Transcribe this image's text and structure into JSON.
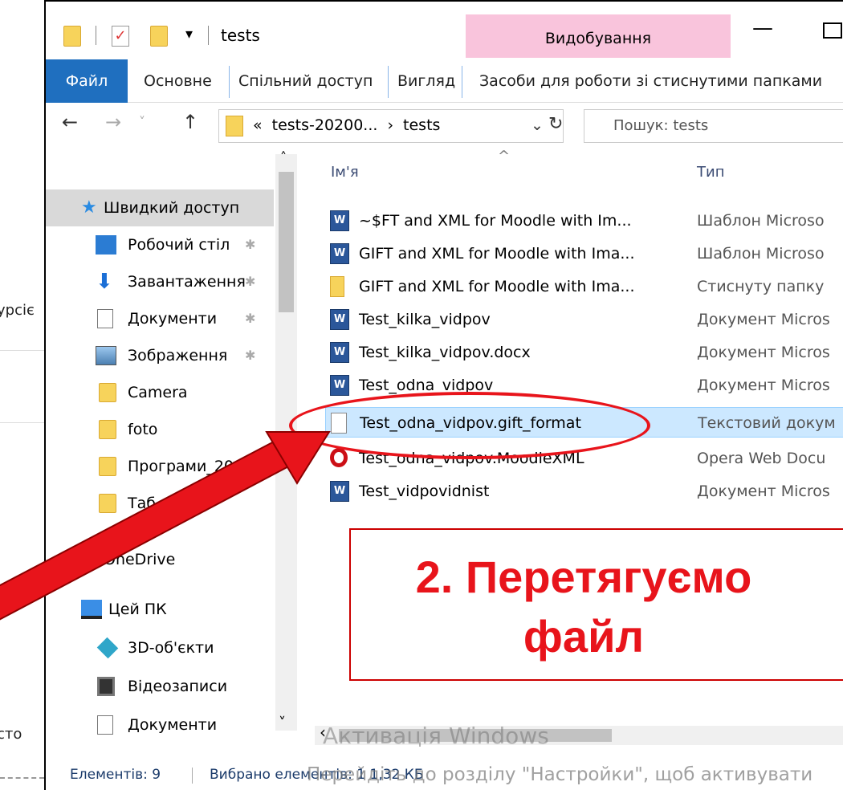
{
  "background": {
    "left_text_1": "урсіє",
    "left_text_2": "сто"
  },
  "window": {
    "title": "tests",
    "quick_access_dropdown": "▾",
    "contextual_tab_title": "Видобування",
    "minimize": "—"
  },
  "ribbon": {
    "tabs": [
      {
        "label": "Файл",
        "active": true
      },
      {
        "label": "Основне"
      },
      {
        "label": "Спільний доступ"
      },
      {
        "label": "Вигляд"
      },
      {
        "label": "Засоби для роботи зі стиснутими папками"
      }
    ]
  },
  "address": {
    "path": [
      "«",
      "tests-20200...",
      "›",
      "tests"
    ],
    "search_placeholder": "Пошук: tests"
  },
  "navpane": {
    "items": [
      {
        "label": "Швидкий доступ",
        "icon": "star-icon",
        "selected": true
      },
      {
        "label": "Робочий стіл",
        "icon": "desktop-icon",
        "pinned": true
      },
      {
        "label": "Завантаження",
        "icon": "download-arrow-icon",
        "pinned": true
      },
      {
        "label": "Документи",
        "icon": "document-icon",
        "pinned": true
      },
      {
        "label": "Зображення",
        "icon": "picture-icon",
        "pinned": true
      },
      {
        "label": "Camera",
        "icon": "folder-icon"
      },
      {
        "label": "foto",
        "icon": "folder-icon"
      },
      {
        "label": "Програми_20",
        "icon": "folder-icon"
      },
      {
        "label": "Таб",
        "icon": "folder-icon"
      },
      {
        "label": "OneDrive",
        "icon": "cloud-icon"
      },
      {
        "label": "Цей ПК",
        "icon": "computer-icon"
      },
      {
        "label": "3D-об'єкти",
        "icon": "cube-icon"
      },
      {
        "label": "Відеозаписи",
        "icon": "film-icon"
      },
      {
        "label": "Документи",
        "icon": "document-icon"
      }
    ]
  },
  "filelist": {
    "columns": {
      "name": "Ім'я",
      "type": "Тип"
    },
    "files": [
      {
        "name": "~$FT and XML for Moodle with Im...",
        "type": "Шаблон Microso",
        "icon": "word-template-icon"
      },
      {
        "name": "GIFT and XML for Moodle with Ima...",
        "type": "Шаблон Microso",
        "icon": "word-template-icon"
      },
      {
        "name": "GIFT and XML for Moodle with Ima...",
        "type": "Стиснуту папку",
        "icon": "zip-folder-icon"
      },
      {
        "name": "Test_kilka_vidpov",
        "type": "Документ Micros",
        "icon": "word-doc-icon"
      },
      {
        "name": "Test_kilka_vidpov.docx",
        "type": "Документ Micros",
        "icon": "word-doc-icon"
      },
      {
        "name": "Test_odna_vidpov",
        "type": "Документ Micros",
        "icon": "word-doc-icon"
      },
      {
        "name": "Test_odna_vidpov.gift_format",
        "type": "Текстовий докум",
        "icon": "text-file-icon",
        "selected": true
      },
      {
        "name": "Test_odna_vidpov.MoodleXML",
        "type": "Opera Web Docu",
        "icon": "opera-icon"
      },
      {
        "name": "Test_vidpovidnist",
        "type": "Документ Micros",
        "icon": "word-doc-icon"
      }
    ]
  },
  "status": {
    "count": "Елементів: 9",
    "selection": "Вибрано елементів: 1 1,32 КБ"
  },
  "watermark": {
    "line1": "Активація Windows",
    "line2": "Перейдіть до розділу \"Настройки\", щоб активувати"
  },
  "annotation": {
    "text_line1": "2. Перетягуємо",
    "text_line2": "файл",
    "color": "#e8141b"
  }
}
